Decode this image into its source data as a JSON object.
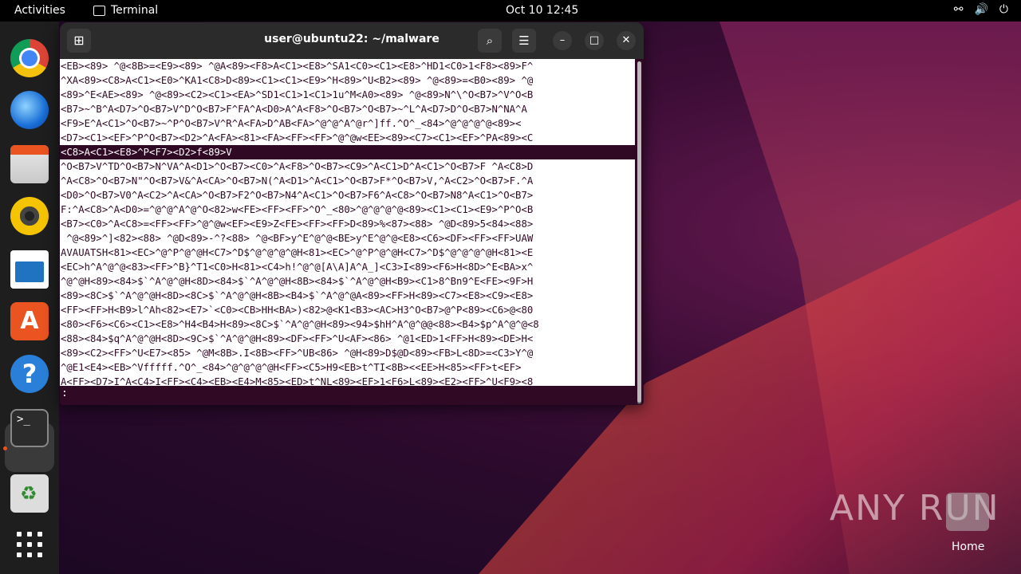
{
  "topbar": {
    "activities": "Activities",
    "app_name": "Terminal",
    "clock": "Oct 10  12:45",
    "tray": [
      "⚯",
      "🔊",
      "⏻"
    ]
  },
  "window": {
    "title": "user@ubuntu22: ~/malware",
    "new_tab_icon": "⊞",
    "search_icon": "⌕",
    "menu_icon": "☰",
    "minimize_icon": "–",
    "maximize_icon": "□",
    "close_icon": "✕"
  },
  "terminal": {
    "lines": [
      "<EB><89> ^@<8B>=<E9><89> ^@A<89><F8>A<C1><E8>^SA1<C0><C1><E8>^HD1<C0>1<F8><89>F^",
      "^XA<89><C8>A<C1><E0>^KA1<C8>D<89><C1><C1><E9>^H<89>^U<B2><89> ^@<89>=<B0><89> ^@",
      "<89>^E<AE><89> ^@<89><C2><C1><EA>^SD1<C1>1<C1>1u^M<A0><89> ^@<89>N^\\^O<B7>^V^O<B",
      "<B7>~^B^A<D7>^O<B7>V^D^O<B7>F^FA^A<D0>A^A<F8>^O<B7>^O<B7>~^L^A<D7>D^O<B7>N^NA^A",
      "<F9>E^A<C1>^O<B7>~^P^O<B7>V^R^A<FA>D^AB<FA>^@^@^A^@r^]ff.^O^_<84>^@^@^@^@<89><",
      "<D7><C1><EF>^P^O<B7><D2>^A<FA><81><FA><FF><FF>^@^@w<EE><89><C7><C1><EF>^PA<89><C",
      "<C8>A<C1><E8>^P<F7><D2>f<89>V",
      "^O<B7>V^TD^O<B7>N^VA^A<D1>^O<B7><C0>^A<F8>^O<B7><C9>^A<C1>D^A<C1>^O<B7>F ^A<C8>D",
      "^A<C8>^O<B7>N\"^O<B7>V&^A<CA>^O<B7>N(^A<D1>^A<C1>^O<B7>F*^O<B7>V,^A<C2>^O<B7>F.^A",
      "<D0>^O<B7>V0^A<C2>^A<CA>^O<B7>F2^O<B7>N4^A<C1>^O<B7>F6^A<C8>^O<B7>N8^A<C1>^O<B7>",
      "F:^A<C8>^A<D0>=^@^@^A^@^O<82>w<FE><FF><FF>^O^_<80>^@^@^@^@<89><C1><C1><E9>^P^O<B",
      "<B7><C0>^A<C8>=<FF><FF>^@^@w<EF><E9>Z<FE><FF><FF>D<89>%<87><88> ^@D<89>5<84><88>",
      " ^@<89>^]<82><88> ^@D<89>-^?<88> ^@<BF>y^E^@^@<BE>y^E^@^@<E8><C6><DF><FF><FF>UAW",
      "AVAUATSH<81><EC>^@^P^@^@H<C7>^D$^@^@^@^@H<81><EC>^@^P^@^@H<C7>^D$^@^@^@^@H<81><E",
      "<EC>h^A^@^@<83><FF>^B}^T1<C0>H<81><C4>h!^@^@[A\\A]A^A_]<C3>I<89><F6>H<8D>^E<BA>x^",
      "^@^@H<89><84>$`^A^@^@H<8D><84>$`^A^@^@H<8B><84>$`^A^@^@H<B9><C1>8^Bn9^E<FE><9F>H",
      "<89><8C>$`^A^@^@H<8D><8C>$`^A^@^@H<8B><B4>$`^A^@^@A<89><FF>H<89><C7><E8><C9><E8>",
      "<FF><FF>H<B9>l^Ah<82><E7>`<C0><CB>HH<BA>)<82>@<K1<B3><AC>H3^O<B7>@^P<89><C6>@<80",
      "<80><F6><C6><C1><E8>^H4<B4>H<89><8C>$`^A^@^@H<89><94>$hH^A^@^@@<88><B4>$p^A^@^@<8",
      "<88><84>$q^A^@^@H<8D><9C>$`^A^@^@H<89><DF><FF>^U<AF><86> ^@1<ED>1<FF>H<89><DE>H<",
      "<89><C2><FF>^U<E7><85> ^@M<8B>.I<8B><FF>^UB<86> ^@H<89>D$@D<89><FB>L<8D>=<C3>Y^@",
      "^@E1<E4><EB>^Vfffff.^O^_<84>^@^@^@^@H<FF><C5>H9<EB>t^TI<8B><<EE>H<85><FF>t<EF>",
      "A<FF><D7>I^A<C4>I<FF><C4><EB><E4>M<85><ED>t^NL<89><EF>1<F6>L<89><E2><FF>^U<F9><8"
    ],
    "inverted_line_index": 6,
    "prompt": ":"
  },
  "dock": {
    "items": [
      "chrome",
      "thunderbird",
      "files",
      "rhythmbox",
      "libreoffice-writer",
      "app-center",
      "help",
      "terminal",
      "trash",
      "show-apps"
    ]
  },
  "watermark": {
    "text": "ANY RUN",
    "home_label": "Home"
  }
}
